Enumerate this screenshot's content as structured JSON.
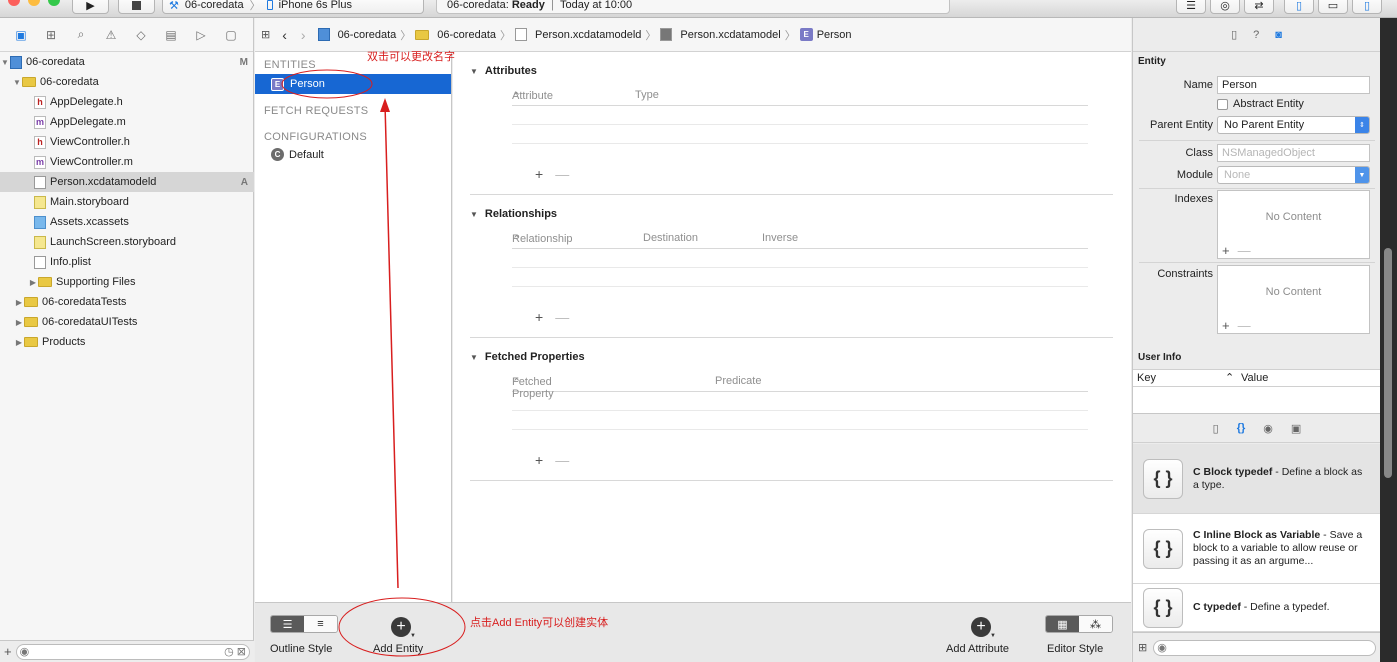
{
  "toolbar": {
    "scheme_target": "06-coredata",
    "scheme_device": "iPhone 6s Plus",
    "status_project": "06-coredata:",
    "status_state": "Ready",
    "status_separator": "|",
    "status_time": "Today at 10:00"
  },
  "navigator": {
    "tree": [
      {
        "label": "06-coredata",
        "type": "project",
        "badge": "M",
        "indent": 0,
        "expanded": true
      },
      {
        "label": "06-coredata",
        "type": "folder",
        "badge": "",
        "indent": 1,
        "expanded": true
      },
      {
        "label": "AppDelegate.h",
        "type": "h",
        "badge": "",
        "indent": 2
      },
      {
        "label": "AppDelegate.m",
        "type": "m",
        "badge": "",
        "indent": 2
      },
      {
        "label": "ViewController.h",
        "type": "h",
        "badge": "",
        "indent": 2
      },
      {
        "label": "ViewController.m",
        "type": "m",
        "badge": "",
        "indent": 2
      },
      {
        "label": "Person.xcdatamodeld",
        "type": "doc",
        "badge": "A",
        "indent": 2,
        "selected": true
      },
      {
        "label": "Main.storyboard",
        "type": "sb",
        "badge": "",
        "indent": 2
      },
      {
        "label": "Assets.xcassets",
        "type": "assets",
        "badge": "",
        "indent": 2
      },
      {
        "label": "LaunchScreen.storyboard",
        "type": "sb",
        "badge": "",
        "indent": 2
      },
      {
        "label": "Info.plist",
        "type": "doc",
        "badge": "",
        "indent": 2
      },
      {
        "label": "Supporting Files",
        "type": "folder",
        "badge": "",
        "indent": 2,
        "expanded": false
      },
      {
        "label": "06-coredataTests",
        "type": "folder",
        "badge": "",
        "indent": 1,
        "expanded": false
      },
      {
        "label": "06-coredataUITests",
        "type": "folder",
        "badge": "",
        "indent": 1,
        "expanded": false
      },
      {
        "label": "Products",
        "type": "folder",
        "badge": "",
        "indent": 1,
        "expanded": false
      }
    ]
  },
  "jumpbar": {
    "crumbs": [
      "06-coredata",
      "06-coredata",
      "Person.xcdatamodeld",
      "Person.xcdatamodel",
      "Person"
    ]
  },
  "entity_list": {
    "entities_header": "ENTITIES",
    "entities": [
      "Person"
    ],
    "fetch_header": "FETCH REQUESTS",
    "config_header": "CONFIGURATIONS",
    "configurations": [
      "Default"
    ]
  },
  "editor": {
    "attributes": {
      "title": "Attributes",
      "col1": "Attribute",
      "col2": "Type"
    },
    "relationships": {
      "title": "Relationships",
      "col1": "Relationship",
      "col2": "Destination",
      "col3": "Inverse"
    },
    "fetched": {
      "title": "Fetched Properties",
      "col1": "Fetched Property",
      "col2": "Predicate"
    },
    "add_symbol": "+",
    "remove_symbol": "—"
  },
  "bottombar": {
    "outline_style": "Outline Style",
    "add_entity": "Add Entity",
    "add_attribute": "Add Attribute",
    "editor_style": "Editor Style"
  },
  "inspector": {
    "section_entity": "Entity",
    "name_label": "Name",
    "name_value": "Person",
    "abstract_label": "Abstract Entity",
    "parent_label": "Parent Entity",
    "parent_value": "No Parent Entity",
    "class_label": "Class",
    "class_placeholder": "NSManagedObject",
    "module_label": "Module",
    "module_value": "None",
    "indexes_label": "Indexes",
    "constraints_label": "Constraints",
    "no_content": "No Content",
    "user_info": "User Info",
    "key_col": "Key",
    "value_col": "Value"
  },
  "library": {
    "items": [
      {
        "title": "C Block typedef",
        "desc": " - Define a block as a type."
      },
      {
        "title": "C Inline Block as Variable",
        "desc": " - Save a block to a variable to allow reuse or passing it as an argume..."
      },
      {
        "title": "C typedef",
        "desc": " - Define a typedef."
      }
    ],
    "icon_glyph": "{ }"
  },
  "annotations": {
    "rename_hint": "双击可以更改名字",
    "add_entity_hint": "点击Add Entity可以创建实体"
  },
  "colors": {
    "selection": "#1767d3",
    "accent": "#1f7ae0",
    "annotation": "#d81e1e"
  }
}
